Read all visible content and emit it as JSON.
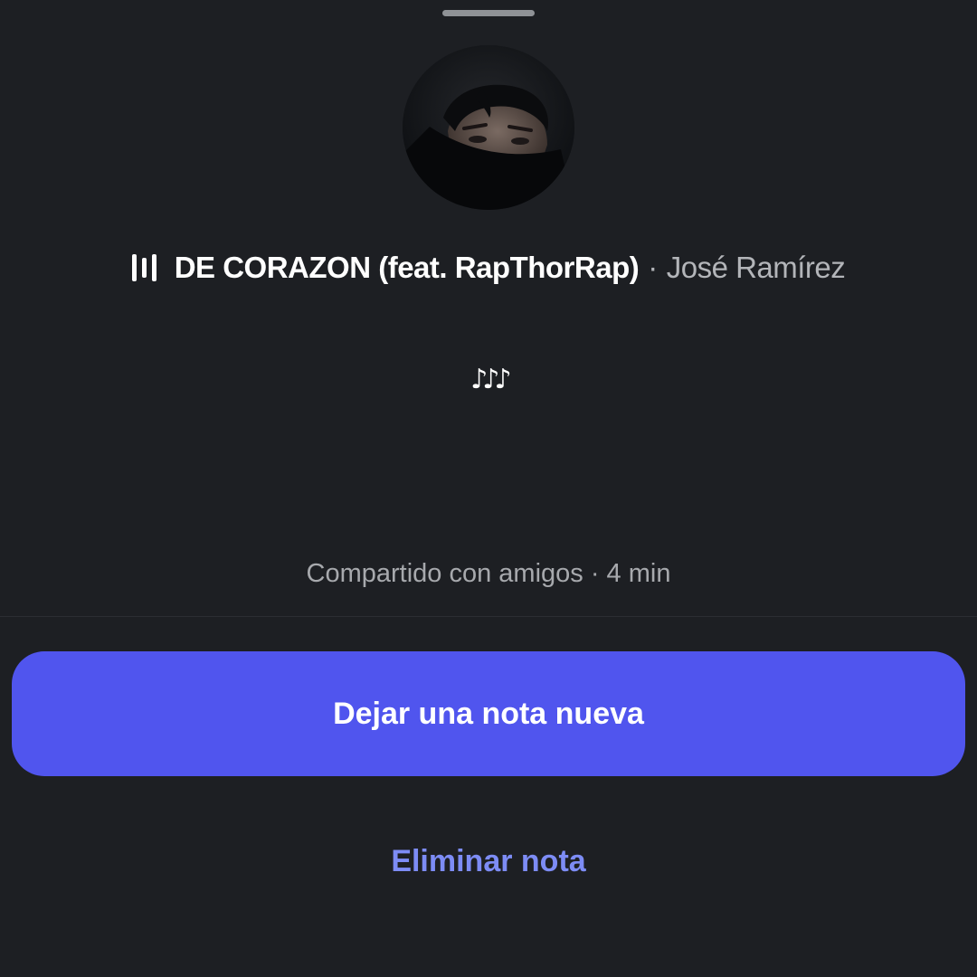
{
  "song": {
    "icon": "equalizer-icon",
    "title": "DE CORAZON (feat. RapThorRap)",
    "separator": "·",
    "artist": "José Ramírez"
  },
  "avatar": {
    "icon": "profile-photo"
  },
  "note": {
    "text": "♪♪♪"
  },
  "meta": {
    "text": "Compartido con amigos · 4 min"
  },
  "actions": {
    "primary_label": "Dejar una nota nueva",
    "secondary_label": "Eliminar nota"
  },
  "colors": {
    "background": "#1d1f23",
    "primary_button": "#5055ee",
    "link": "#7d8cf5"
  }
}
